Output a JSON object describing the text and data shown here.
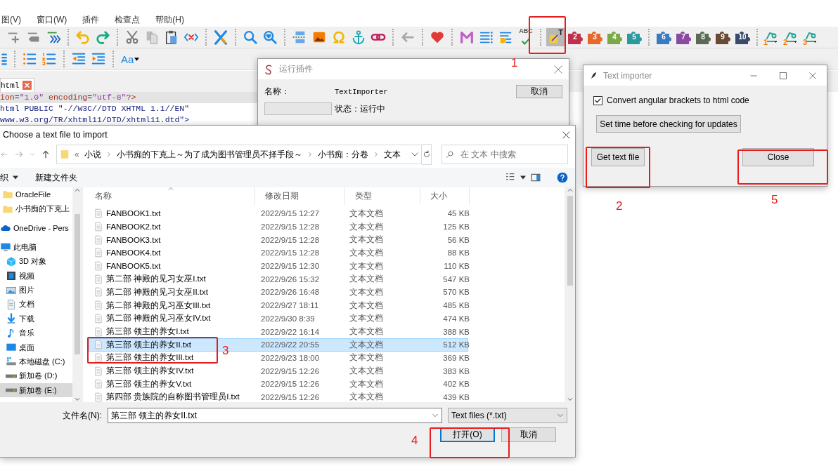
{
  "menu": [
    {
      "label": "图(V)"
    },
    {
      "label": "窗口(W)"
    },
    {
      "label": "插件"
    },
    {
      "label": "检查点"
    },
    {
      "label": "帮助(H)"
    }
  ],
  "toolbar": {
    "spellcheck_label": "ABC",
    "plugin_label": "T",
    "font_button": "Aa",
    "plugins": [
      {
        "label": "2",
        "color": "#c0304a"
      },
      {
        "label": "3",
        "color": "#e8672a"
      },
      {
        "label": "4",
        "color": "#7aaa48"
      },
      {
        "label": "5",
        "color": "#2a9aa0"
      },
      {
        "label": "6",
        "color": "#3a7ac0"
      },
      {
        "label": "7",
        "color": "#8a4aa0"
      },
      {
        "label": "8",
        "color": "#5a6a55"
      },
      {
        "label": "9",
        "color": "#6a4a35"
      },
      {
        "label": "10",
        "color": "#3a4a6a"
      }
    ],
    "macros": [
      {
        "label": "1"
      },
      {
        "label": "2"
      },
      {
        "label": "3"
      }
    ]
  },
  "editor": {
    "tab": "html",
    "lines": [
      {
        "current": true,
        "segments": [
          {
            "text": "ion",
            "kind": "attr"
          },
          {
            "text": "=",
            "kind": "tag"
          },
          {
            "text": "\"1.0\"",
            "kind": "value"
          },
          {
            "text": " encoding",
            "kind": "attr"
          },
          {
            "text": "=",
            "kind": "tag"
          },
          {
            "text": "\"utf-8\"",
            "kind": "value"
          },
          {
            "text": "?>",
            "kind": "attr"
          }
        ]
      },
      {
        "current": false,
        "segments": [
          {
            "text": "html PUBLIC \"-//W3C//DTD XHTML 1.1//EN\"",
            "kind": "tag"
          }
        ]
      },
      {
        "current": false,
        "segments": [
          {
            "text": "www.w3.org/TR/xhtml11/DTD/xhtml11.dtd\">",
            "kind": "tag"
          }
        ]
      }
    ]
  },
  "plugin_dialog": {
    "title": "运行插件",
    "name_label": "名称：",
    "name_value": "TextImporter",
    "cancel": "取消",
    "status": "状态：运行中",
    "progress": {
      "level": 0
    }
  },
  "importer": {
    "title": "Text importer",
    "checkbox": {
      "label": "Convert angular brackets to html code",
      "checked": true
    },
    "buttons": [
      "Set time before checking for updates",
      "Get text file",
      "Close"
    ]
  },
  "file_dialog": {
    "title": "Choose a text file to import",
    "overflow": "«",
    "crumbs": [
      "小说",
      "小书痴的下克上～为了成为图书管理员不择手段～",
      "小书痴：分卷",
      "文本"
    ],
    "search_placeholder": "在 文本 中搜索",
    "organize": "织",
    "new_folder": "新建文件夹",
    "nav": [
      {
        "label": "OracleFile",
        "kind": "folder",
        "selected": false
      },
      {
        "label": "小书痴的下克上",
        "kind": "folder",
        "selected": false
      },
      {
        "label": "OneDrive - Pers",
        "kind": "cloud",
        "selected": false
      },
      {
        "label": "此电脑",
        "kind": "pc",
        "selected": false,
        "children": [
          {
            "label": "3D 对象",
            "kind": "cube",
            "selected": false
          },
          {
            "label": "视频",
            "kind": "video",
            "selected": false
          },
          {
            "label": "图片",
            "kind": "pictures",
            "selected": false
          },
          {
            "label": "文档",
            "kind": "docs",
            "selected": false
          },
          {
            "label": "下载",
            "kind": "download",
            "selected": false
          },
          {
            "label": "音乐",
            "kind": "music",
            "selected": false
          },
          {
            "label": "桌面",
            "kind": "desktop",
            "selected": false
          },
          {
            "label": "本地磁盘 (C:)",
            "kind": "sysdisk",
            "selected": false
          },
          {
            "label": "新加卷 (D:)",
            "kind": "disk",
            "selected": false
          },
          {
            "label": "新加卷 (E:)",
            "kind": "disk",
            "selected": true
          }
        ]
      }
    ],
    "columns": [
      "名称",
      "修改日期",
      "类型",
      "大小"
    ],
    "rows": [
      {
        "name": "FANBOOK1.txt",
        "date": "2022/9/15 12:27",
        "type": "文本文档",
        "size": "45 KB",
        "selected": false
      },
      {
        "name": "FANBOOK2.txt",
        "date": "2022/9/15 12:28",
        "type": "文本文档",
        "size": "125 KB",
        "selected": false
      },
      {
        "name": "FANBOOK3.txt",
        "date": "2022/9/15 12:28",
        "type": "文本文档",
        "size": "56 KB",
        "selected": false
      },
      {
        "name": "FANBOOK4.txt",
        "date": "2022/9/15 12:28",
        "type": "文本文档",
        "size": "88 KB",
        "selected": false
      },
      {
        "name": "FANBOOK5.txt",
        "date": "2022/9/15 12:30",
        "type": "文本文档",
        "size": "110 KB",
        "selected": false
      },
      {
        "name": "第二部 神殿的见习女巫I.txt",
        "date": "2022/9/26 15:32",
        "type": "文本文档",
        "size": "547 KB",
        "selected": false
      },
      {
        "name": "第二部 神殿的见习女巫II.txt",
        "date": "2022/9/26 16:48",
        "type": "文本文档",
        "size": "570 KB",
        "selected": false
      },
      {
        "name": "第二部 神殿的见习巫女III.txt",
        "date": "2022/9/27 18:11",
        "type": "文本文档",
        "size": "485 KB",
        "selected": false
      },
      {
        "name": "第二部 神殿的见习巫女IV.txt",
        "date": "2022/9/30 8:39",
        "type": "文本文档",
        "size": "474 KB",
        "selected": false
      },
      {
        "name": "第三部 领主的养女I.txt",
        "date": "2022/9/22 16:14",
        "type": "文本文档",
        "size": "388 KB",
        "selected": false
      },
      {
        "name": "第三部 领主的养女II.txt",
        "date": "2022/9/22 20:55",
        "type": "文本文档",
        "size": "512 KB",
        "selected": true
      },
      {
        "name": "第三部 领主的养女III.txt",
        "date": "2022/9/23 18:00",
        "type": "文本文档",
        "size": "369 KB",
        "selected": false
      },
      {
        "name": "第三部 领主的养女IV.txt",
        "date": "2022/9/15 12:26",
        "type": "文本文档",
        "size": "383 KB",
        "selected": false
      },
      {
        "name": "第三部 领主的养女V.txt",
        "date": "2022/9/15 12:26",
        "type": "文本文档",
        "size": "402 KB",
        "selected": false
      },
      {
        "name": "第四部 贵族院的自称图书管理员I.txt",
        "date": "2022/9/15 12:26",
        "type": "文本文档",
        "size": "439 KB",
        "selected": false
      }
    ],
    "filename_label": "文件名(N):",
    "filename": "第三部 领主的养女II.txt",
    "filter": "Text files (*.txt)",
    "open": "打开(O)",
    "cancel": "取消"
  },
  "annotations": [
    {
      "label": "1"
    },
    {
      "label": "2"
    },
    {
      "label": "3"
    },
    {
      "label": "4"
    },
    {
      "label": "5"
    }
  ]
}
